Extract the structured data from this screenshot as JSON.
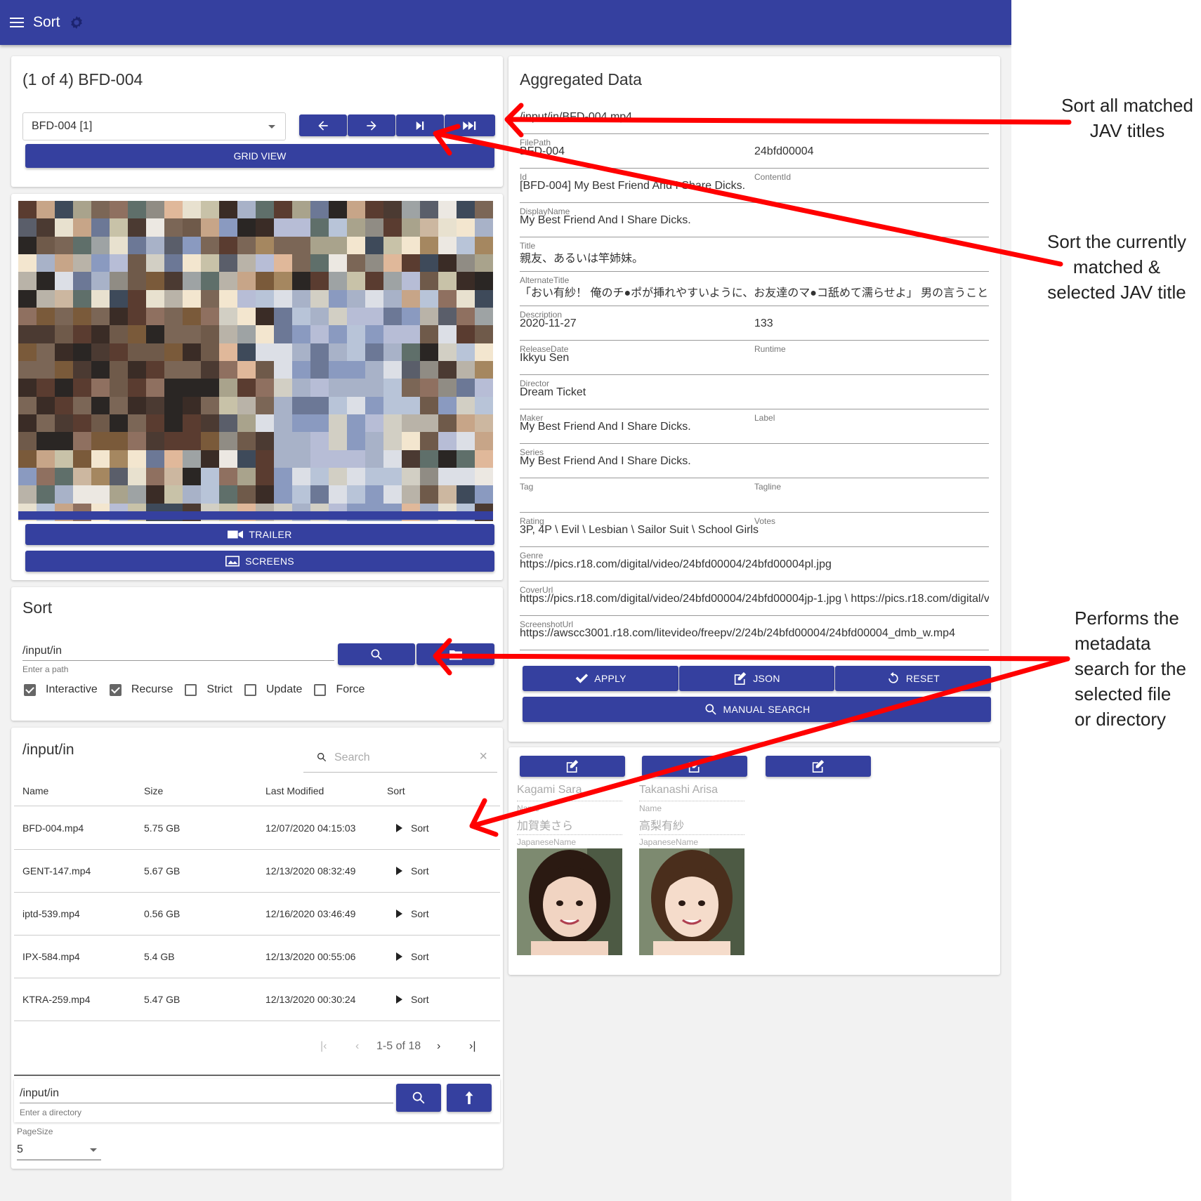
{
  "app": {
    "title": "Sort"
  },
  "movie_card": {
    "heading": "(1 of 4) BFD-004",
    "select_value": "BFD-004 [1]",
    "grid_view_label": "GRID VIEW",
    "trailer_label": "TRAILER",
    "screens_label": "SCREENS"
  },
  "sort_card": {
    "heading": "Sort",
    "path_value": "/input/in",
    "path_hint": "Enter a path",
    "options": [
      {
        "label": "Interactive",
        "checked": true
      },
      {
        "label": "Recurse",
        "checked": true
      },
      {
        "label": "Strict",
        "checked": false
      },
      {
        "label": "Update",
        "checked": false
      },
      {
        "label": "Force",
        "checked": false
      }
    ]
  },
  "file_browser": {
    "heading": "/input/in",
    "search_placeholder": "Search",
    "columns": [
      "Name",
      "Size",
      "Last Modified",
      "Sort"
    ],
    "rows": [
      {
        "name": "BFD-004.mp4",
        "size": "5.75 GB",
        "modified": "12/07/2020 04:15:03",
        "action": "Sort"
      },
      {
        "name": "GENT-147.mp4",
        "size": "5.67 GB",
        "modified": "12/13/2020 08:32:49",
        "action": "Sort"
      },
      {
        "name": "iptd-539.mp4",
        "size": "0.56 GB",
        "modified": "12/16/2020 03:46:49",
        "action": "Sort"
      },
      {
        "name": "IPX-584.mp4",
        "size": "5.4 GB",
        "modified": "12/13/2020 00:55:06",
        "action": "Sort"
      },
      {
        "name": "KTRA-259.mp4",
        "size": "5.47 GB",
        "modified": "12/13/2020 00:30:24",
        "action": "Sort"
      }
    ],
    "pagination": "1-5 of 18",
    "dir_value": "/input/in",
    "dir_hint": "Enter a directory",
    "page_size_label": "PageSize",
    "page_size_value": "5"
  },
  "aggregated": {
    "heading": "Aggregated Data",
    "rows": [
      {
        "value": "/input/in/BFD-004.mp4",
        "label": "FilePath",
        "value2": "",
        "label2": ""
      },
      {
        "value": "BFD-004",
        "label": "Id",
        "value2": "24bfd00004",
        "label2": "ContentId"
      },
      {
        "value": "[BFD-004] My Best Friend And I Share Dicks.",
        "label": "DisplayName",
        "value2": "",
        "label2": ""
      },
      {
        "value": "My Best Friend And I Share Dicks.",
        "label": "Title",
        "value2": "",
        "label2": ""
      },
      {
        "value": "親友、あるいは竿姉妹。",
        "label": "AlternateTitle",
        "value2": "",
        "label2": ""
      },
      {
        "value": "「おい有紗！ 俺のチ●ポが挿れやすいように、お友達のマ●コ舐めて濡らせよ」 男の言うことを",
        "label": "Description",
        "value2": "",
        "label2": ""
      },
      {
        "value": "2020-11-27",
        "label": "ReleaseDate",
        "value2": "133",
        "label2": "Runtime"
      },
      {
        "value": "Ikkyu Sen",
        "label": "Director",
        "value2": "",
        "label2": ""
      },
      {
        "value": "Dream Ticket",
        "label": "Maker",
        "value2": "",
        "label2": "Label"
      },
      {
        "value": "My Best Friend And I Share Dicks.",
        "label": "Series",
        "value2": "",
        "label2": ""
      },
      {
        "value": "My Best Friend And I Share Dicks.",
        "label": "Tag",
        "value2": "",
        "label2": "Tagline"
      },
      {
        "value": "",
        "label": "Rating",
        "value2": "",
        "label2": "Votes"
      },
      {
        "value": "3P, 4P \\ Evil \\ Lesbian \\ Sailor Suit \\ School Girls",
        "label": "Genre",
        "value2": "",
        "label2": ""
      },
      {
        "value": "https://pics.r18.com/digital/video/24bfd00004/24bfd00004pl.jpg",
        "label": "CoverUrl",
        "value2": "",
        "label2": ""
      },
      {
        "value": "https://pics.r18.com/digital/video/24bfd00004/24bfd00004jp-1.jpg \\ https://pics.r18.com/digital/video",
        "label": "ScreenshotUrl",
        "value2": "",
        "label2": ""
      },
      {
        "value": "https://awscc3001.r18.com/litevideo/freepv/2/24b/24bfd00004/24bfd00004_dmb_w.mp4",
        "label": "",
        "value2": "",
        "label2": ""
      }
    ],
    "apply_label": "APPLY",
    "json_label": "JSON",
    "reset_label": "RESET",
    "manual_search_label": "MANUAL SEARCH"
  },
  "actresses": [
    {
      "name": "Kagami Sara",
      "name_label": "Name",
      "japanese": "加賀美さら",
      "japanese_label": "JapaneseName"
    },
    {
      "name": "Takanashi Arisa",
      "name_label": "Name",
      "japanese": "高梨有紗",
      "japanese_label": "JapaneseName"
    }
  ],
  "annotations": {
    "sort_all": [
      "Sort all matched",
      "JAV titles"
    ],
    "sort_current": [
      "Sort the currently",
      "matched &",
      "selected JAV title"
    ],
    "performs": [
      "Performs the",
      "metadata",
      "search for the",
      "selected file",
      "or directory"
    ]
  },
  "colors": {
    "primary": "#35409f",
    "arrow": "#ff0000"
  },
  "icons": [
    "menu-icon",
    "gear-icon",
    "arrow-left-icon",
    "arrow-right-icon",
    "skip-next-icon",
    "skip-all-icon",
    "video-camera-icon",
    "image-icon",
    "search-icon",
    "folder-icon",
    "check-icon",
    "edit-icon",
    "reset-icon",
    "close-icon",
    "first-page-icon",
    "prev-page-icon",
    "next-page-icon",
    "last-page-icon",
    "upload-icon"
  ]
}
